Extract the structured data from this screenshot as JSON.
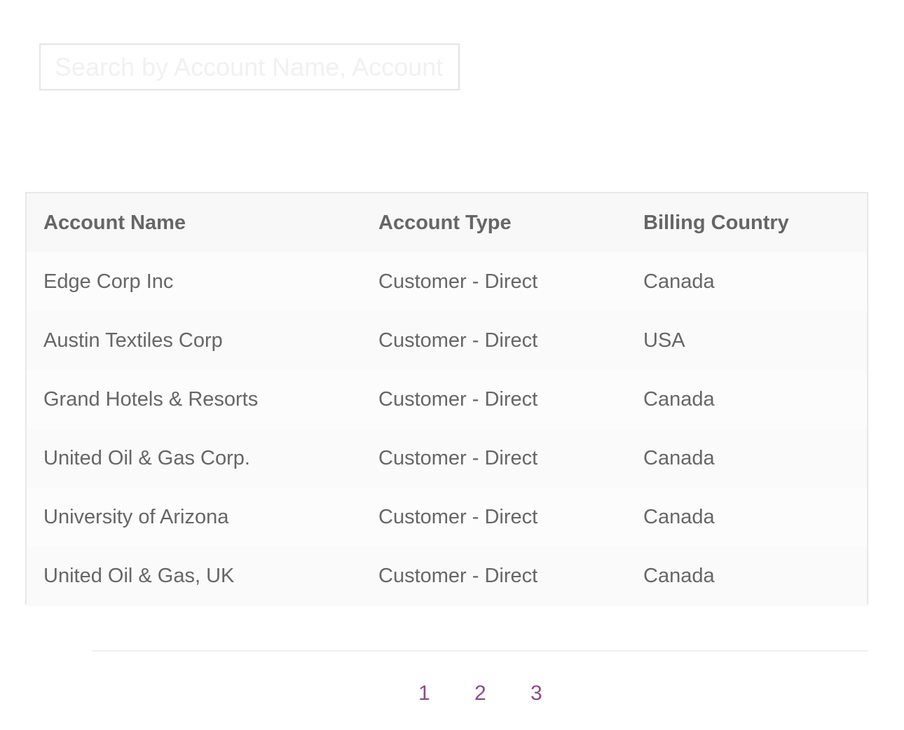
{
  "search": {
    "placeholder": "Search by Account Name, Account Type, Billing Country",
    "value": ""
  },
  "table": {
    "columns": [
      "Account Name",
      "Account Type",
      "Billing Country"
    ],
    "rows": [
      {
        "name": "Edge Corp Inc",
        "type": "Customer - Direct",
        "country": "Canada"
      },
      {
        "name": "Austin Textiles Corp",
        "type": "Customer - Direct",
        "country": "USA"
      },
      {
        "name": "Grand Hotels & Resorts",
        "type": "Customer - Direct",
        "country": "Canada"
      },
      {
        "name": "United Oil & Gas Corp.",
        "type": "Customer - Direct",
        "country": "Canada"
      },
      {
        "name": "University of Arizona",
        "type": "Customer - Direct",
        "country": "Canada"
      },
      {
        "name": "United Oil & Gas, UK",
        "type": "Customer - Direct",
        "country": "Canada"
      }
    ]
  },
  "pagination": {
    "pages": [
      "1",
      "2",
      "3"
    ]
  },
  "colors": {
    "pagination_link": "#8a4c88",
    "text": "#666666",
    "header_bg": "#f8f8f8"
  }
}
